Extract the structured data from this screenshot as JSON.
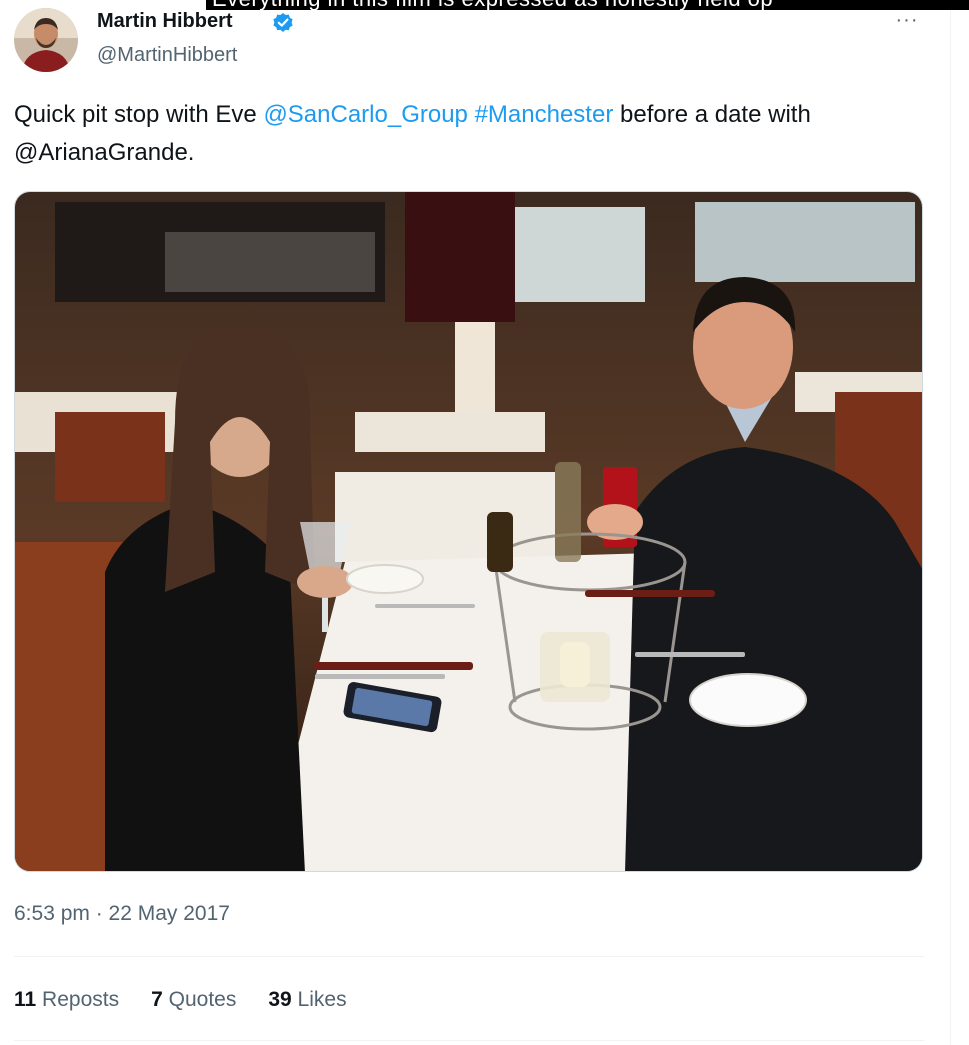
{
  "caption": {
    "text": "Everything in this film is expressed as honestly held op"
  },
  "tweet": {
    "author": {
      "display_name": "Martin Hibbert",
      "handle": "@MartinHibbert",
      "verified": true,
      "avatar_icon": "avatar-photo"
    },
    "more_icon": "···",
    "text_segments": [
      {
        "text": "Quick pit stop with Eve ",
        "type": "plain"
      },
      {
        "text": "@SanCarlo_Group",
        "type": "mention"
      },
      {
        "text": " ",
        "type": "plain"
      },
      {
        "text": "#Manchester",
        "type": "hashtag"
      },
      {
        "text": " before a date with @ArianaGrande.",
        "type": "plain"
      }
    ],
    "media": {
      "type": "photo",
      "icon": "restaurant-photo"
    },
    "timestamp": "6:53 pm · 22 May 2017",
    "stats": {
      "reposts_count": "11",
      "reposts_label": "Reposts",
      "quotes_count": "7",
      "quotes_label": "Quotes",
      "likes_count": "39",
      "likes_label": "Likes"
    }
  },
  "colors": {
    "link": "#1d9bf0",
    "verified": "#1d9bf0",
    "secondary_text": "#536471"
  }
}
